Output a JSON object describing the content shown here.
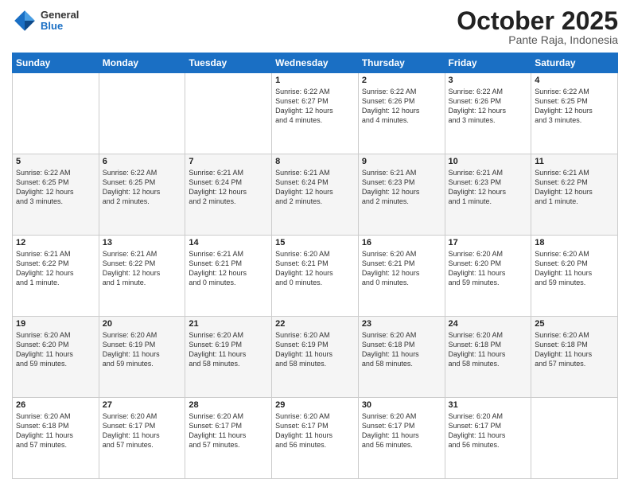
{
  "header": {
    "logo_general": "General",
    "logo_blue": "Blue",
    "title": "October 2025",
    "subtitle": "Pante Raja, Indonesia"
  },
  "days_of_week": [
    "Sunday",
    "Monday",
    "Tuesday",
    "Wednesday",
    "Thursday",
    "Friday",
    "Saturday"
  ],
  "weeks": [
    [
      {
        "day": "",
        "info": ""
      },
      {
        "day": "",
        "info": ""
      },
      {
        "day": "",
        "info": ""
      },
      {
        "day": "1",
        "info": "Sunrise: 6:22 AM\nSunset: 6:27 PM\nDaylight: 12 hours\nand 4 minutes."
      },
      {
        "day": "2",
        "info": "Sunrise: 6:22 AM\nSunset: 6:26 PM\nDaylight: 12 hours\nand 4 minutes."
      },
      {
        "day": "3",
        "info": "Sunrise: 6:22 AM\nSunset: 6:26 PM\nDaylight: 12 hours\nand 3 minutes."
      },
      {
        "day": "4",
        "info": "Sunrise: 6:22 AM\nSunset: 6:25 PM\nDaylight: 12 hours\nand 3 minutes."
      }
    ],
    [
      {
        "day": "5",
        "info": "Sunrise: 6:22 AM\nSunset: 6:25 PM\nDaylight: 12 hours\nand 3 minutes."
      },
      {
        "day": "6",
        "info": "Sunrise: 6:22 AM\nSunset: 6:25 PM\nDaylight: 12 hours\nand 2 minutes."
      },
      {
        "day": "7",
        "info": "Sunrise: 6:21 AM\nSunset: 6:24 PM\nDaylight: 12 hours\nand 2 minutes."
      },
      {
        "day": "8",
        "info": "Sunrise: 6:21 AM\nSunset: 6:24 PM\nDaylight: 12 hours\nand 2 minutes."
      },
      {
        "day": "9",
        "info": "Sunrise: 6:21 AM\nSunset: 6:23 PM\nDaylight: 12 hours\nand 2 minutes."
      },
      {
        "day": "10",
        "info": "Sunrise: 6:21 AM\nSunset: 6:23 PM\nDaylight: 12 hours\nand 1 minute."
      },
      {
        "day": "11",
        "info": "Sunrise: 6:21 AM\nSunset: 6:22 PM\nDaylight: 12 hours\nand 1 minute."
      }
    ],
    [
      {
        "day": "12",
        "info": "Sunrise: 6:21 AM\nSunset: 6:22 PM\nDaylight: 12 hours\nand 1 minute."
      },
      {
        "day": "13",
        "info": "Sunrise: 6:21 AM\nSunset: 6:22 PM\nDaylight: 12 hours\nand 1 minute."
      },
      {
        "day": "14",
        "info": "Sunrise: 6:21 AM\nSunset: 6:21 PM\nDaylight: 12 hours\nand 0 minutes."
      },
      {
        "day": "15",
        "info": "Sunrise: 6:20 AM\nSunset: 6:21 PM\nDaylight: 12 hours\nand 0 minutes."
      },
      {
        "day": "16",
        "info": "Sunrise: 6:20 AM\nSunset: 6:21 PM\nDaylight: 12 hours\nand 0 minutes."
      },
      {
        "day": "17",
        "info": "Sunrise: 6:20 AM\nSunset: 6:20 PM\nDaylight: 11 hours\nand 59 minutes."
      },
      {
        "day": "18",
        "info": "Sunrise: 6:20 AM\nSunset: 6:20 PM\nDaylight: 11 hours\nand 59 minutes."
      }
    ],
    [
      {
        "day": "19",
        "info": "Sunrise: 6:20 AM\nSunset: 6:20 PM\nDaylight: 11 hours\nand 59 minutes."
      },
      {
        "day": "20",
        "info": "Sunrise: 6:20 AM\nSunset: 6:19 PM\nDaylight: 11 hours\nand 59 minutes."
      },
      {
        "day": "21",
        "info": "Sunrise: 6:20 AM\nSunset: 6:19 PM\nDaylight: 11 hours\nand 58 minutes."
      },
      {
        "day": "22",
        "info": "Sunrise: 6:20 AM\nSunset: 6:19 PM\nDaylight: 11 hours\nand 58 minutes."
      },
      {
        "day": "23",
        "info": "Sunrise: 6:20 AM\nSunset: 6:18 PM\nDaylight: 11 hours\nand 58 minutes."
      },
      {
        "day": "24",
        "info": "Sunrise: 6:20 AM\nSunset: 6:18 PM\nDaylight: 11 hours\nand 58 minutes."
      },
      {
        "day": "25",
        "info": "Sunrise: 6:20 AM\nSunset: 6:18 PM\nDaylight: 11 hours\nand 57 minutes."
      }
    ],
    [
      {
        "day": "26",
        "info": "Sunrise: 6:20 AM\nSunset: 6:18 PM\nDaylight: 11 hours\nand 57 minutes."
      },
      {
        "day": "27",
        "info": "Sunrise: 6:20 AM\nSunset: 6:17 PM\nDaylight: 11 hours\nand 57 minutes."
      },
      {
        "day": "28",
        "info": "Sunrise: 6:20 AM\nSunset: 6:17 PM\nDaylight: 11 hours\nand 57 minutes."
      },
      {
        "day": "29",
        "info": "Sunrise: 6:20 AM\nSunset: 6:17 PM\nDaylight: 11 hours\nand 56 minutes."
      },
      {
        "day": "30",
        "info": "Sunrise: 6:20 AM\nSunset: 6:17 PM\nDaylight: 11 hours\nand 56 minutes."
      },
      {
        "day": "31",
        "info": "Sunrise: 6:20 AM\nSunset: 6:17 PM\nDaylight: 11 hours\nand 56 minutes."
      },
      {
        "day": "",
        "info": ""
      }
    ]
  ]
}
